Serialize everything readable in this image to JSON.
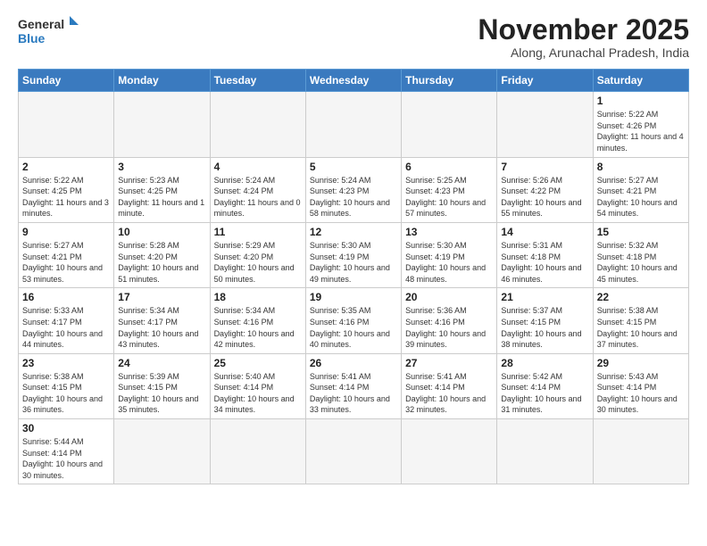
{
  "logo": {
    "text_general": "General",
    "text_blue": "Blue"
  },
  "header": {
    "title": "November 2025",
    "subtitle": "Along, Arunachal Pradesh, India"
  },
  "weekdays": [
    "Sunday",
    "Monday",
    "Tuesday",
    "Wednesday",
    "Thursday",
    "Friday",
    "Saturday"
  ],
  "weeks": [
    [
      {
        "day": "",
        "info": ""
      },
      {
        "day": "",
        "info": ""
      },
      {
        "day": "",
        "info": ""
      },
      {
        "day": "",
        "info": ""
      },
      {
        "day": "",
        "info": ""
      },
      {
        "day": "",
        "info": ""
      },
      {
        "day": "1",
        "info": "Sunrise: 5:22 AM\nSunset: 4:26 PM\nDaylight: 11 hours\nand 4 minutes."
      }
    ],
    [
      {
        "day": "2",
        "info": "Sunrise: 5:22 AM\nSunset: 4:25 PM\nDaylight: 11 hours\nand 3 minutes."
      },
      {
        "day": "3",
        "info": "Sunrise: 5:23 AM\nSunset: 4:25 PM\nDaylight: 11 hours\nand 1 minute."
      },
      {
        "day": "4",
        "info": "Sunrise: 5:24 AM\nSunset: 4:24 PM\nDaylight: 11 hours\nand 0 minutes."
      },
      {
        "day": "5",
        "info": "Sunrise: 5:24 AM\nSunset: 4:23 PM\nDaylight: 10 hours\nand 58 minutes."
      },
      {
        "day": "6",
        "info": "Sunrise: 5:25 AM\nSunset: 4:23 PM\nDaylight: 10 hours\nand 57 minutes."
      },
      {
        "day": "7",
        "info": "Sunrise: 5:26 AM\nSunset: 4:22 PM\nDaylight: 10 hours\nand 55 minutes."
      },
      {
        "day": "8",
        "info": "Sunrise: 5:27 AM\nSunset: 4:21 PM\nDaylight: 10 hours\nand 54 minutes."
      }
    ],
    [
      {
        "day": "9",
        "info": "Sunrise: 5:27 AM\nSunset: 4:21 PM\nDaylight: 10 hours\nand 53 minutes."
      },
      {
        "day": "10",
        "info": "Sunrise: 5:28 AM\nSunset: 4:20 PM\nDaylight: 10 hours\nand 51 minutes."
      },
      {
        "day": "11",
        "info": "Sunrise: 5:29 AM\nSunset: 4:20 PM\nDaylight: 10 hours\nand 50 minutes."
      },
      {
        "day": "12",
        "info": "Sunrise: 5:30 AM\nSunset: 4:19 PM\nDaylight: 10 hours\nand 49 minutes."
      },
      {
        "day": "13",
        "info": "Sunrise: 5:30 AM\nSunset: 4:19 PM\nDaylight: 10 hours\nand 48 minutes."
      },
      {
        "day": "14",
        "info": "Sunrise: 5:31 AM\nSunset: 4:18 PM\nDaylight: 10 hours\nand 46 minutes."
      },
      {
        "day": "15",
        "info": "Sunrise: 5:32 AM\nSunset: 4:18 PM\nDaylight: 10 hours\nand 45 minutes."
      }
    ],
    [
      {
        "day": "16",
        "info": "Sunrise: 5:33 AM\nSunset: 4:17 PM\nDaylight: 10 hours\nand 44 minutes."
      },
      {
        "day": "17",
        "info": "Sunrise: 5:34 AM\nSunset: 4:17 PM\nDaylight: 10 hours\nand 43 minutes."
      },
      {
        "day": "18",
        "info": "Sunrise: 5:34 AM\nSunset: 4:16 PM\nDaylight: 10 hours\nand 42 minutes."
      },
      {
        "day": "19",
        "info": "Sunrise: 5:35 AM\nSunset: 4:16 PM\nDaylight: 10 hours\nand 40 minutes."
      },
      {
        "day": "20",
        "info": "Sunrise: 5:36 AM\nSunset: 4:16 PM\nDaylight: 10 hours\nand 39 minutes."
      },
      {
        "day": "21",
        "info": "Sunrise: 5:37 AM\nSunset: 4:15 PM\nDaylight: 10 hours\nand 38 minutes."
      },
      {
        "day": "22",
        "info": "Sunrise: 5:38 AM\nSunset: 4:15 PM\nDaylight: 10 hours\nand 37 minutes."
      }
    ],
    [
      {
        "day": "23",
        "info": "Sunrise: 5:38 AM\nSunset: 4:15 PM\nDaylight: 10 hours\nand 36 minutes."
      },
      {
        "day": "24",
        "info": "Sunrise: 5:39 AM\nSunset: 4:15 PM\nDaylight: 10 hours\nand 35 minutes."
      },
      {
        "day": "25",
        "info": "Sunrise: 5:40 AM\nSunset: 4:14 PM\nDaylight: 10 hours\nand 34 minutes."
      },
      {
        "day": "26",
        "info": "Sunrise: 5:41 AM\nSunset: 4:14 PM\nDaylight: 10 hours\nand 33 minutes."
      },
      {
        "day": "27",
        "info": "Sunrise: 5:41 AM\nSunset: 4:14 PM\nDaylight: 10 hours\nand 32 minutes."
      },
      {
        "day": "28",
        "info": "Sunrise: 5:42 AM\nSunset: 4:14 PM\nDaylight: 10 hours\nand 31 minutes."
      },
      {
        "day": "29",
        "info": "Sunrise: 5:43 AM\nSunset: 4:14 PM\nDaylight: 10 hours\nand 30 minutes."
      }
    ],
    [
      {
        "day": "30",
        "info": "Sunrise: 5:44 AM\nSunset: 4:14 PM\nDaylight: 10 hours\nand 30 minutes."
      },
      {
        "day": "",
        "info": ""
      },
      {
        "day": "",
        "info": ""
      },
      {
        "day": "",
        "info": ""
      },
      {
        "day": "",
        "info": ""
      },
      {
        "day": "",
        "info": ""
      },
      {
        "day": "",
        "info": ""
      }
    ]
  ]
}
